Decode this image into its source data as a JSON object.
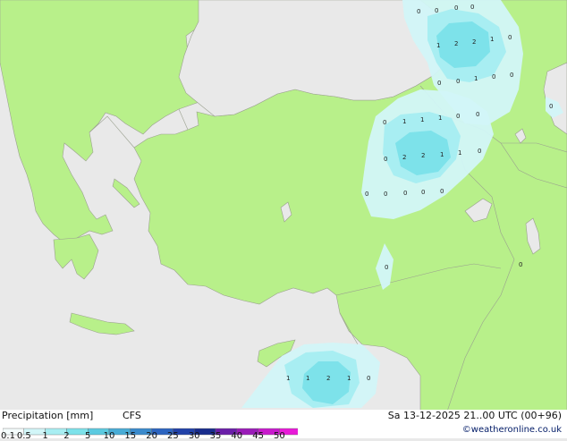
{
  "legend": {
    "title": "Precipitation [mm]",
    "model": "CFS",
    "ticks": [
      "0.1",
      "0.5",
      "1",
      "2",
      "5",
      "10",
      "15",
      "20",
      "25",
      "30",
      "35",
      "40",
      "45",
      "50"
    ],
    "colors": [
      "#f5fdfd",
      "#d2f6f8",
      "#a8eef2",
      "#7de2ea",
      "#5ccae0",
      "#48acd6",
      "#3a8acc",
      "#2c64c0",
      "#2141a8",
      "#182c8c",
      "#6a1ea8",
      "#9a1cb8",
      "#c81acc",
      "#e81ad8"
    ]
  },
  "run_info": "Sa 13-12-2025 21..00 UTC (00+96)",
  "credit": "©weatheronline.co.uk",
  "colors": {
    "land": "#b8f08a",
    "sea": "#e9e9e9",
    "border": "#9aa08f",
    "precip_light": "#d2f6f8",
    "precip_mid": "#a8eef2",
    "precip_high": "#7de2ea"
  },
  "values": {
    "north_cluster": [
      "0",
      "0",
      "0",
      "0",
      "1",
      "2",
      "2",
      "1",
      "0",
      "0",
      "0",
      "1",
      "0",
      "0"
    ],
    "east_cluster": [
      "0",
      "1",
      "1",
      "1",
      "0",
      "0",
      "0",
      "2",
      "2",
      "1",
      "1",
      "0"
    ],
    "east_row": [
      "0",
      "0",
      "0",
      "0",
      "0",
      "0"
    ],
    "center": [
      "0"
    ],
    "south_cluster": [
      "1",
      "1",
      "2",
      "1",
      "0"
    ],
    "far_east": [
      "0"
    ]
  }
}
